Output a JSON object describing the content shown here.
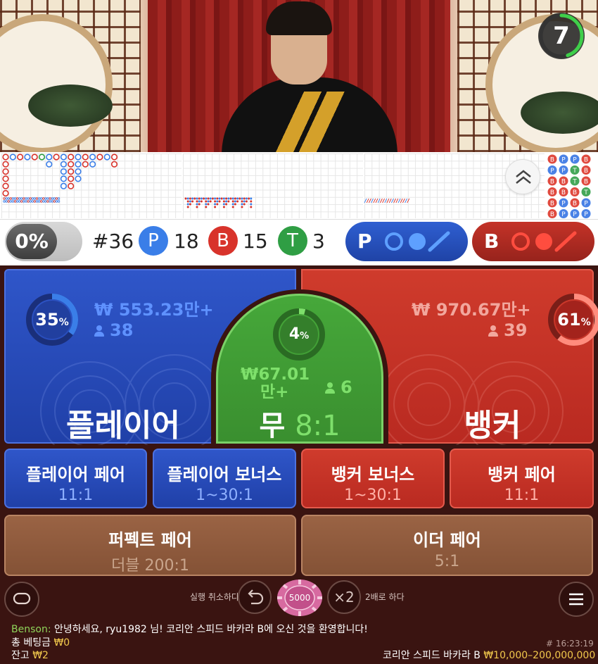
{
  "timer": {
    "value": "7",
    "fraction": 0.45
  },
  "stats": {
    "percent_toggle": "0%",
    "round": "#36",
    "player_letter": "P",
    "player_count": "18",
    "banker_letter": "B",
    "banker_count": "15",
    "tie_letter": "T",
    "tie_count": "3",
    "predict_player": "P",
    "predict_banker": "B"
  },
  "colors": {
    "player": "#2f56c9",
    "banker": "#cf3b2c",
    "tie": "#46a83a",
    "gold": "#f2c94c"
  },
  "player": {
    "percent": "35",
    "percent_sign": "%",
    "amount": "₩ 553.23만+",
    "users": "38",
    "label": "플레이어"
  },
  "banker": {
    "percent": "61",
    "percent_sign": "%",
    "amount": "₩ 970.67만+",
    "users": "39",
    "label": "뱅커"
  },
  "tie": {
    "percent": "4",
    "percent_sign": "%",
    "amount_line1": "₩67.01",
    "amount_line2": "만+",
    "users": "6",
    "label": "무",
    "payout": "8:1"
  },
  "side_bets": [
    {
      "title": "플레이어 페어",
      "odds": "11:1"
    },
    {
      "title": "플레이어 보너스",
      "odds": "1~30:1"
    },
    {
      "title": "뱅커 보너스",
      "odds": "1~30:1"
    },
    {
      "title": "뱅커 페어",
      "odds": "11:1"
    }
  ],
  "wide_bets": [
    {
      "title": "퍼펙트 페어",
      "odds": "더블 200:1"
    },
    {
      "title": "이더 페어",
      "odds": "5:1"
    }
  ],
  "controls": {
    "undo_label": "실행 취소하다",
    "chip_value": "5000",
    "double_icon": "×2",
    "double_label": "2배로 하다"
  },
  "chat": {
    "user": "Benson:",
    "message": "안녕하세요, ryu1982 님! 코리안 스피드 바카라 B에 오신 것을 환영합니다!"
  },
  "footer": {
    "total_bet_label": "총 베팅금",
    "total_bet_value": "₩0",
    "balance_label": "잔고",
    "balance_value": "₩2",
    "round_id": "# 16:23:19",
    "table_name": "코리안 스피드 바카라 B",
    "table_limits": "₩10,000–200,000,000"
  }
}
